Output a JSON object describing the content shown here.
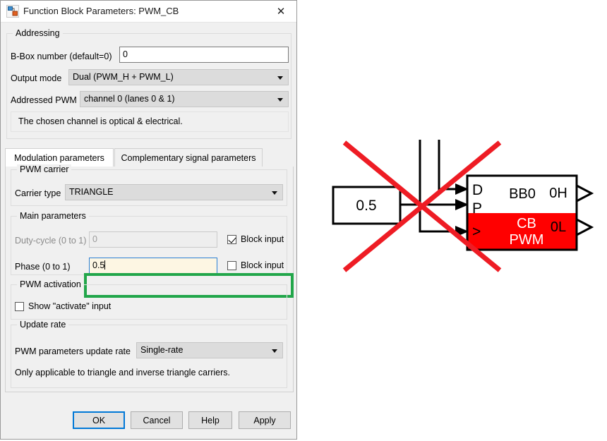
{
  "window": {
    "title": "Function Block Parameters: PWM_CB",
    "icon": "simulink-block-icon",
    "close_icon": "close-icon"
  },
  "addressing": {
    "group_title": "Addressing",
    "bbox_label": "B-Box number (default=0)",
    "bbox_value": "0",
    "output_mode_label": "Output mode",
    "output_mode_value": "Dual (PWM_H + PWM_L)",
    "addressed_pwm_label": "Addressed PWM",
    "addressed_pwm_value": "channel 0 (lanes 0 & 1)",
    "info_text": "The chosen channel is optical & electrical."
  },
  "tabs": [
    {
      "label": "Modulation parameters",
      "active": true
    },
    {
      "label": "Complementary signal parameters",
      "active": false
    }
  ],
  "pwm_carrier": {
    "group_title": "PWM carrier",
    "carrier_type_label": "Carrier type",
    "carrier_type_value": "TRIANGLE"
  },
  "main_parameters": {
    "group_title": "Main parameters",
    "duty_cycle_label": "Duty-cycle (0 to 1)",
    "duty_cycle_value": "0",
    "duty_cycle_block_input_label": "Block input",
    "duty_cycle_block_input_checked": true,
    "phase_label": "Phase (0 to 1)",
    "phase_value": "0.5",
    "phase_block_input_label": "Block input",
    "phase_block_input_checked": false
  },
  "pwm_activation": {
    "group_title": "PWM activation",
    "show_activate_label": "Show \"activate\" input",
    "show_activate_checked": false
  },
  "update_rate": {
    "group_title": "Update rate",
    "rate_label": "PWM parameters update rate",
    "rate_value": "Single-rate",
    "note": "Only applicable to triangle and inverse triangle carriers."
  },
  "buttons": {
    "ok": "OK",
    "cancel": "Cancel",
    "help": "Help",
    "apply": "Apply"
  },
  "diagram": {
    "constant_value": "0.5",
    "block": {
      "port_d": "D",
      "port_p": "P",
      "port_clk": ">",
      "device_label": "BB0",
      "block_name_line1": "CB",
      "block_name_line2": "PWM",
      "out_h": "0H",
      "out_l": "0L",
      "body_color": "#ff0000",
      "header_color": "#ffffff"
    },
    "annotation": {
      "type": "red-cross-out",
      "color": "#ee1c24"
    }
  },
  "colors": {
    "accent_blue": "#0078d7",
    "highlight_green": "#22a64a",
    "annotation_red": "#ee1c24",
    "focus_field_bg": "#fdf6e3"
  }
}
